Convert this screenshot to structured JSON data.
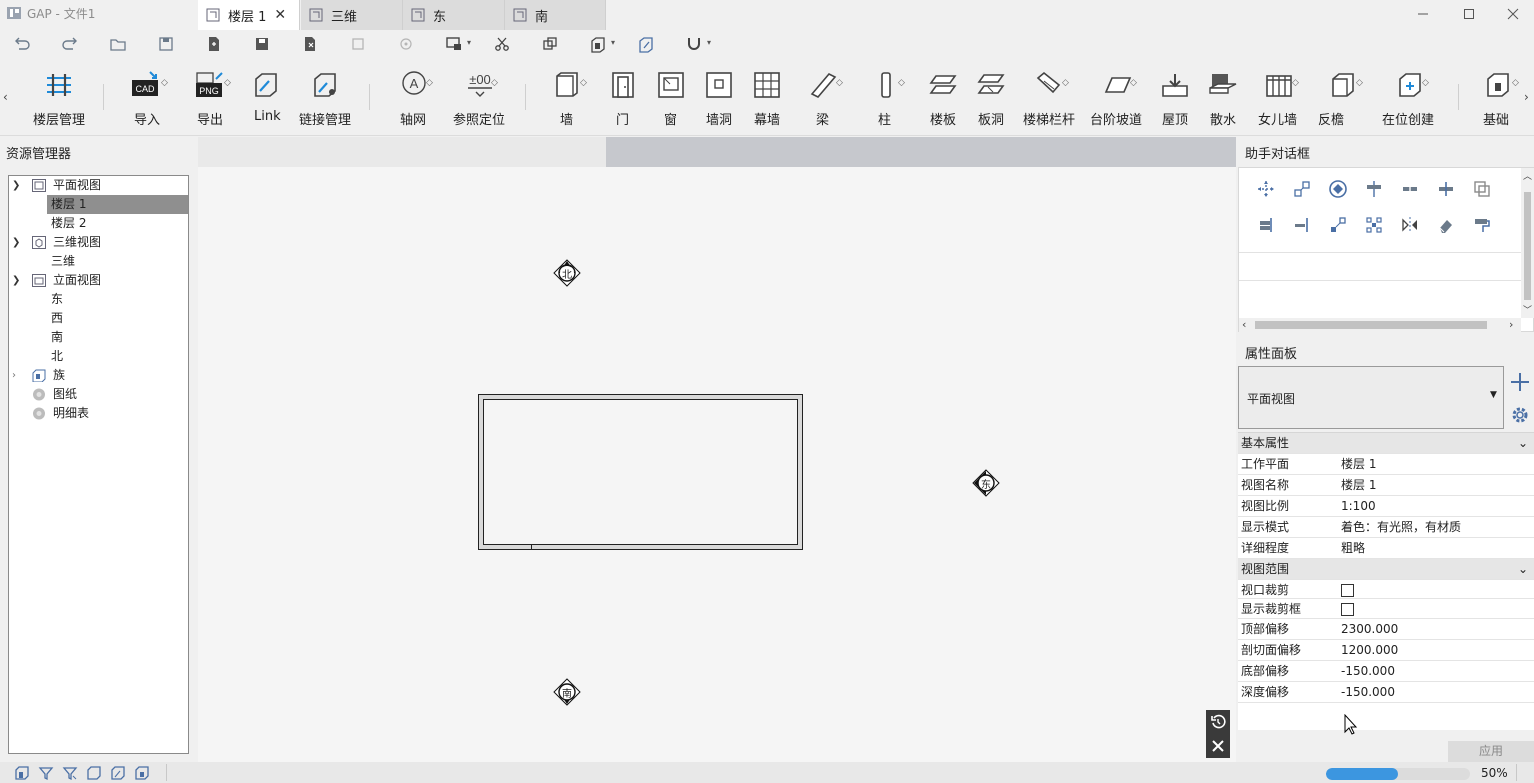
{
  "window": {
    "title": "GAP - 文件1"
  },
  "ribbon": {
    "buttons": [
      "楼层管理",
      "导入",
      "导出",
      "Link",
      "链接管理",
      "轴网",
      "参照定位",
      "墙",
      "门",
      "窗",
      "墙洞",
      "幕墙",
      "梁",
      "柱",
      "楼板",
      "板洞",
      "楼梯栏杆",
      "台阶坡道",
      "屋顶",
      "散水",
      "女儿墙",
      "反檐",
      "在位创建",
      "基础"
    ],
    "import_badge": "CAD",
    "export_badge": "PNG",
    "datum_badge": "±00"
  },
  "resource_manager": {
    "title": "资源管理器",
    "items": [
      {
        "label": "平面视图"
      },
      {
        "label": "楼层 1"
      },
      {
        "label": "楼层 2"
      },
      {
        "label": "三维视图"
      },
      {
        "label": "三维"
      },
      {
        "label": "立面视图"
      },
      {
        "label": "东"
      },
      {
        "label": "西"
      },
      {
        "label": "南"
      },
      {
        "label": "北"
      },
      {
        "label": "族"
      },
      {
        "label": "图纸"
      },
      {
        "label": "明细表"
      }
    ]
  },
  "tabs": [
    {
      "label": "楼层 1"
    },
    {
      "label": "三维"
    },
    {
      "label": "东"
    },
    {
      "label": "南"
    }
  ],
  "canvas": {
    "markers": {
      "north": "北",
      "east": "东",
      "south": "南"
    }
  },
  "assistant": {
    "title": "助手对话框"
  },
  "properties": {
    "title": "属性面板",
    "type_selector": "平面视图",
    "groups": [
      {
        "title": "基本属性",
        "rows": [
          {
            "key": "工作平面",
            "value": "楼层 1"
          },
          {
            "key": "视图名称",
            "value": "楼层 1"
          },
          {
            "key": "视图比例",
            "value": "1:100"
          },
          {
            "key": "显示模式",
            "value": "着色：有光照，有材质"
          },
          {
            "key": "详细程度",
            "value": "粗略"
          }
        ]
      },
      {
        "title": "视图范围",
        "rows": [
          {
            "key": "视口裁剪",
            "checked": false
          },
          {
            "key": "显示裁剪框",
            "checked": false
          },
          {
            "key": "顶部偏移",
            "value": "2300.000"
          },
          {
            "key": "剖切面偏移",
            "value": "1200.000"
          },
          {
            "key": "底部偏移",
            "value": "-150.000"
          },
          {
            "key": "深度偏移",
            "value": "-150.000"
          }
        ]
      }
    ],
    "apply_label": "应用"
  },
  "status": {
    "zoom": "50%",
    "progress": 0.5
  },
  "colors": {
    "accent": "#1f8ad8",
    "progress": "#3c96e0",
    "selection": "#8f8f8f"
  }
}
